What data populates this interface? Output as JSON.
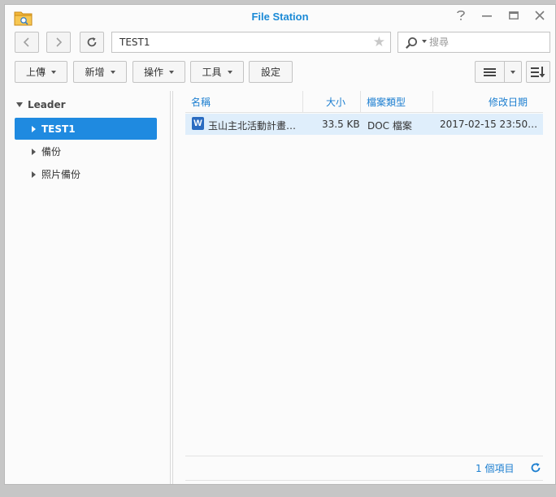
{
  "window": {
    "title": "File Station",
    "controls": [
      "help-icon",
      "minimize-icon",
      "maximize-icon",
      "close-icon"
    ]
  },
  "navbar": {
    "path": "TEST1",
    "search_placeholder": "搜尋"
  },
  "toolbar": {
    "upload_label": "上傳",
    "new_label": "新增",
    "action_label": "操作",
    "tools_label": "工具",
    "settings_label": "設定"
  },
  "sidebar": {
    "root_label": "Leader",
    "items": [
      {
        "label": "TEST1",
        "selected": true
      },
      {
        "label": "備份",
        "selected": false
      },
      {
        "label": "照片備份",
        "selected": false
      }
    ]
  },
  "grid": {
    "columns": {
      "name": "名稱",
      "size": "大小",
      "type": "檔案類型",
      "modified": "修改日期"
    },
    "rows": [
      {
        "icon": "word-doc-icon",
        "icon_letter": "W",
        "name": "玉山主北活動計畫書…",
        "size": "33.5 KB",
        "type": "DOC 檔案",
        "modified": "2017-02-15 23:50…"
      }
    ]
  },
  "status": {
    "item_count": "1 個項目"
  },
  "colors": {
    "accent": "#1f8ae0",
    "title": "#1b8ad6",
    "row_selected": "#dfeefb"
  }
}
